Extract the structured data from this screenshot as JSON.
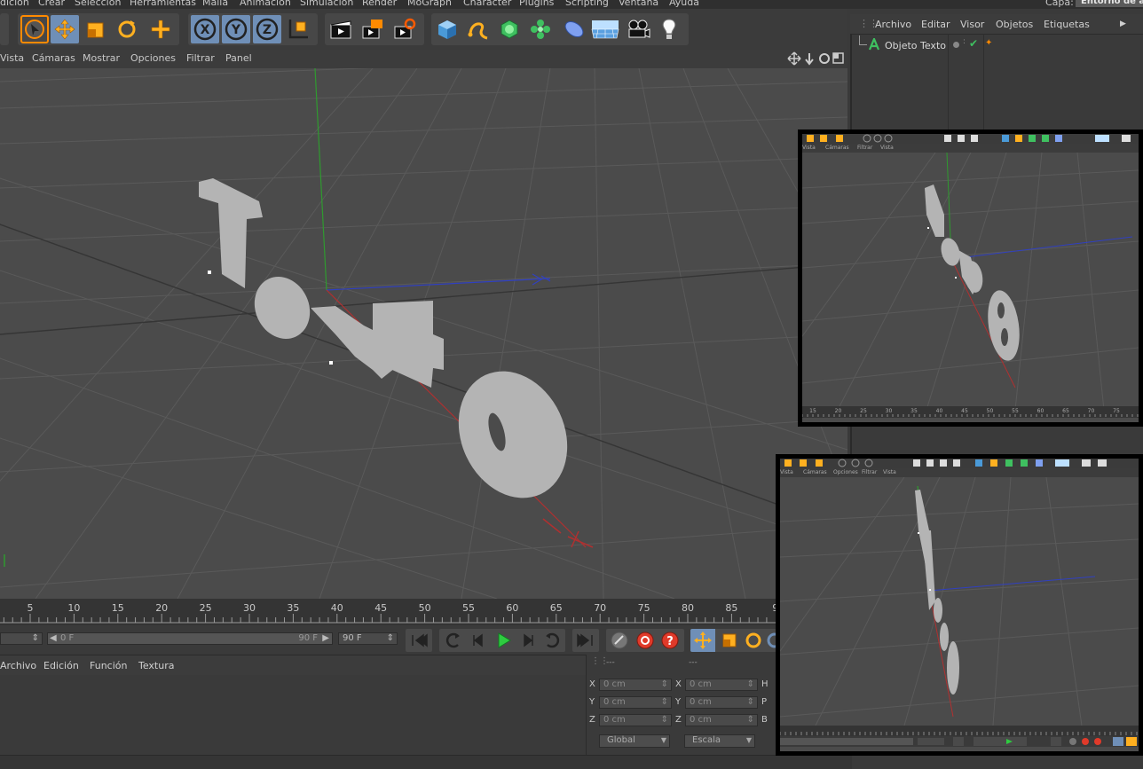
{
  "menu": {
    "items": [
      "dición",
      "Crear",
      "Selección",
      "Herramientas",
      "Malla",
      "Animación",
      "Simulación",
      "Render",
      "MoGraph",
      "Character",
      "Plugins",
      "Scripting",
      "Ventana",
      "Ayuda"
    ],
    "capa_label": "Capa:",
    "capa_value": "Entorno de a"
  },
  "toolbar": {
    "icons": [
      "live-selection-icon",
      "move-icon",
      "scale-icon",
      "rotate-icon",
      "add-icon",
      "x-axis-icon",
      "y-axis-icon",
      "z-axis-icon",
      "coordinate-system-icon",
      "render-view-icon",
      "render-picture-viewer-icon",
      "render-settings-icon",
      "cube-icon",
      "spline-icon",
      "nurbs-icon",
      "array-icon",
      "deformer-icon",
      "floor-icon",
      "camera-icon",
      "light-icon"
    ],
    "axis_labels": [
      "X",
      "Y",
      "Z"
    ]
  },
  "viewport": {
    "menu": [
      "Vista",
      "Cámaras",
      "Mostrar",
      "Opciones",
      "Filtrar",
      "Panel"
    ],
    "object_text": "Texto"
  },
  "objects_panel": {
    "menu": [
      "Archivo",
      "Editar",
      "Visor",
      "Objetos",
      "Etiquetas"
    ],
    "object_name": "Objeto Texto"
  },
  "timeline": {
    "ticks": [
      "5",
      "10",
      "15",
      "20",
      "25",
      "30",
      "35",
      "40",
      "45",
      "50",
      "55",
      "60",
      "65",
      "70",
      "75",
      "80",
      "85",
      "9"
    ],
    "start_field": "0 F",
    "range_end": "90 F",
    "end_field": "90 F"
  },
  "material_manager": {
    "menu": [
      "Archivo",
      "Edición",
      "Función",
      "Textura"
    ]
  },
  "coordinates": {
    "header_left": "---",
    "header_right": "---",
    "rows": [
      {
        "a_label": "X",
        "a_value": "0 cm",
        "b_label": "X",
        "b_value": "0 cm",
        "c_label": "H"
      },
      {
        "a_label": "Y",
        "a_value": "0 cm",
        "b_label": "Y",
        "b_value": "0 cm",
        "c_label": "P"
      },
      {
        "a_label": "Z",
        "a_value": "0 cm",
        "b_label": "Z",
        "b_value": "0 cm",
        "c_label": "B"
      }
    ],
    "mode_left": "Global",
    "mode_right": "Escala"
  },
  "inset_top": {
    "menu": [
      "Vista",
      "Cámaras",
      "Filtrar",
      "Vista"
    ],
    "ticks": [
      "15",
      "20",
      "25",
      "30",
      "35",
      "40",
      "45",
      "50",
      "55",
      "60",
      "65",
      "70",
      "75"
    ]
  },
  "inset_bottom": {
    "menu": [
      "Vista",
      "Cámaras",
      "Opciones",
      "Filtrar",
      "Vista"
    ]
  },
  "colors": {
    "accent_orange": "#ff8a00",
    "active_blue": "#6f8fb7",
    "play_green": "#2ecc40",
    "axis_x": "#b03030",
    "axis_y": "#2f9a2f",
    "axis_z": "#3040c0",
    "text_object": "#b4b4b4"
  }
}
